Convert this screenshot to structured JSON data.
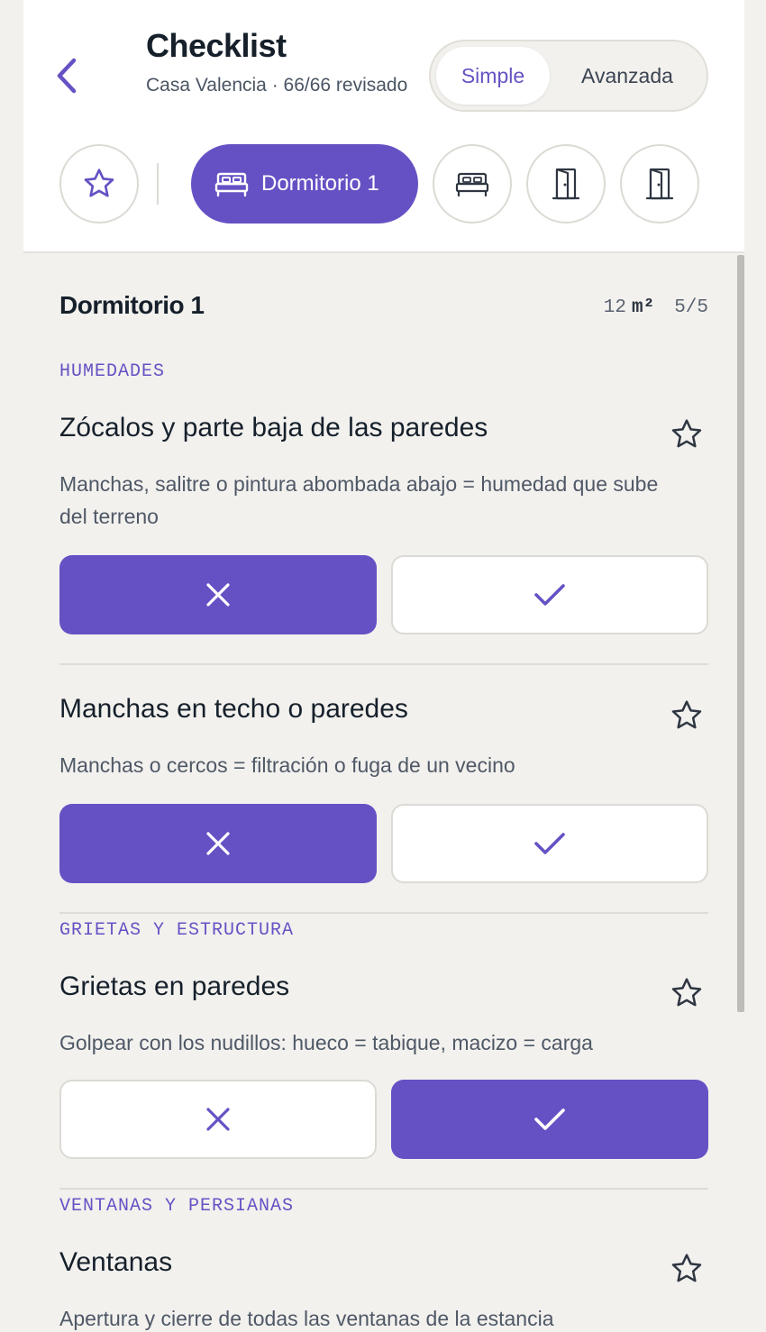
{
  "header": {
    "title": "Checklist",
    "subtitle": "Casa Valencia · 66/66 revisado",
    "modes": {
      "simple": "Simple",
      "avanzada": "Avanzada",
      "selected": "Simple"
    },
    "tabs": {
      "active_label": "Dormitorio 1",
      "icons": [
        "star-icon",
        "bed-icon",
        "bed-icon",
        "door-icon",
        "door-icon"
      ]
    }
  },
  "section": {
    "title": "Dormitorio 1",
    "area_value": "12",
    "area_unit": "m²",
    "progress": "5/5"
  },
  "categories": {
    "humedades": "HUMEDADES",
    "grietas": "GRIETAS Y ESTRUCTURA",
    "ventanas": "VENTANAS Y PERSIANAS"
  },
  "items": [
    {
      "title": "Zócalos y parte baja de las paredes",
      "desc": "Manchas, salitre o pintura abombada abajo = humedad que sube del terreno",
      "answer": "no"
    },
    {
      "title": "Manchas en techo o paredes",
      "desc": "Manchas o cercos = filtración o fuga de un vecino",
      "answer": "no"
    },
    {
      "title": "Grietas en paredes",
      "desc": "Golpear con los nudillos: hueco = tabique, macizo = carga",
      "answer": "yes"
    },
    {
      "title": "Ventanas",
      "desc": "Apertura y cierre de todas las ventanas de la estancia"
    }
  ],
  "colors": {
    "accent": "#6651c4",
    "background": "#f2f1ee",
    "text": "#16202b"
  }
}
